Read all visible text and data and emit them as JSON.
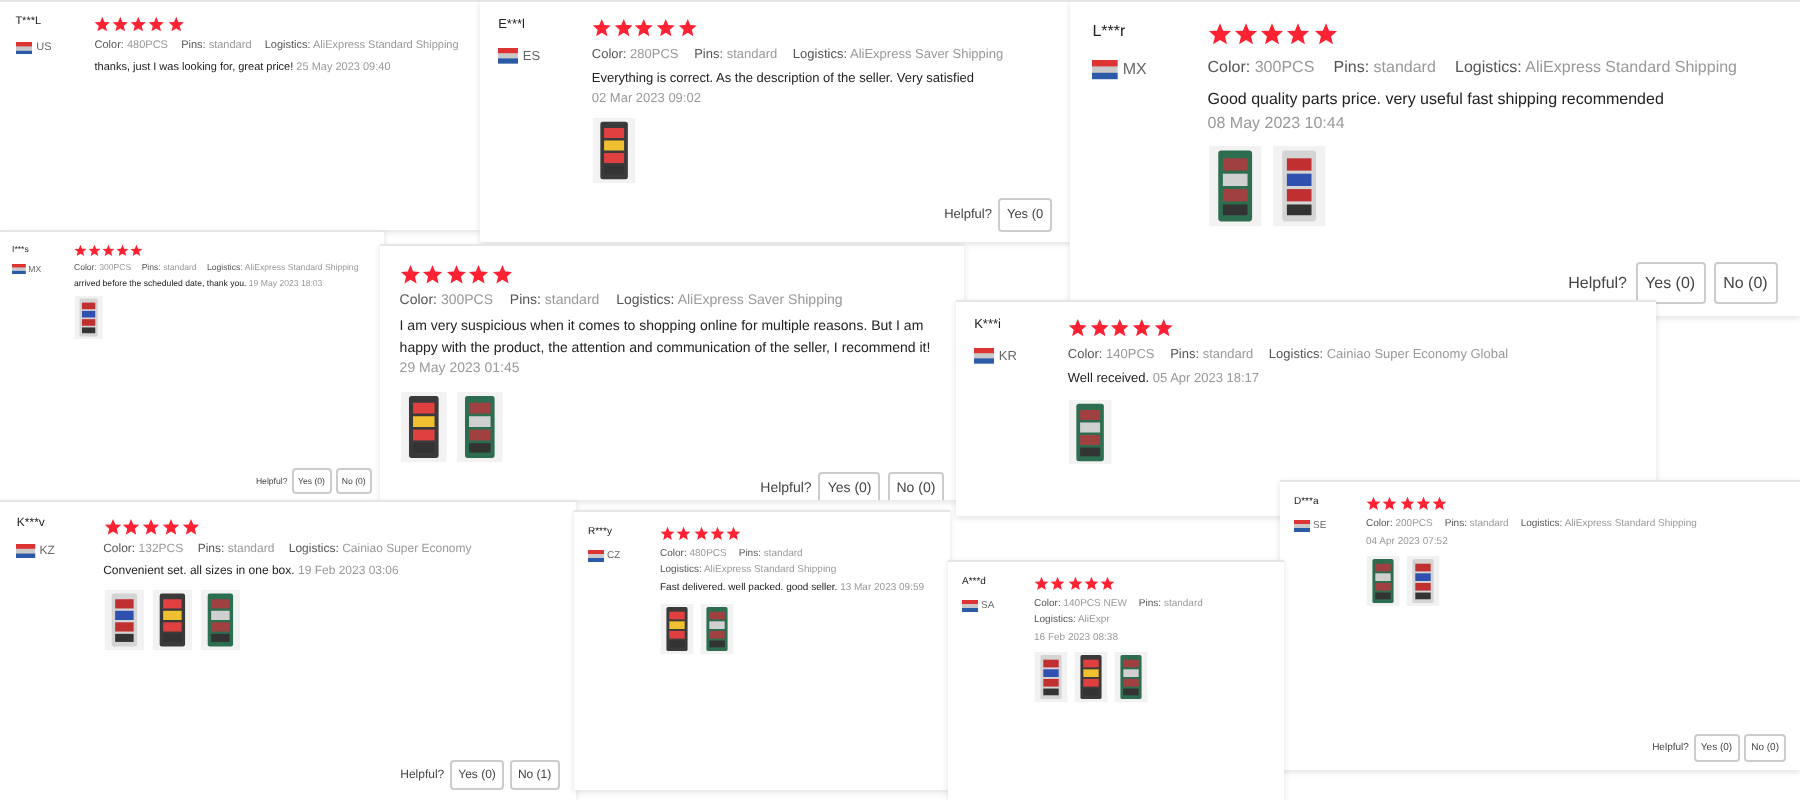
{
  "reviews": [
    {
      "name": "T***L",
      "country": "US",
      "stars": 5,
      "attributes": [
        {
          "label": "Color:",
          "value": "480PCS"
        },
        {
          "label": "Pins:",
          "value": "standard"
        },
        {
          "label": "Logistics:",
          "value": "AliExpress Standard Shipping"
        }
      ],
      "text": "thanks, just I was looking for, great price!",
      "date": "25 May 2023 09:40"
    },
    {
      "name": "E***l",
      "country": "ES",
      "stars": 5,
      "attributes": [
        {
          "label": "Color:",
          "value": "280PCS"
        },
        {
          "label": "Pins:",
          "value": "standard"
        },
        {
          "label": "Logistics:",
          "value": "AliExpress Saver Shipping"
        }
      ],
      "text": "Everything is correct. As the description of the seller. Very satisfied",
      "date": "02 Mar 2023 09:02",
      "photos": [
        {
          "kind": "picture"
        }
      ],
      "helpful": {
        "label": "Helpful?",
        "yes": "Yes (0"
      }
    },
    {
      "name": "L***r",
      "country": "MX",
      "stars": 5,
      "attributes": [
        {
          "label": "Color:",
          "value": "300PCS"
        },
        {
          "label": "Pins:",
          "value": "standard"
        },
        {
          "label": "Logistics:",
          "value": "AliExpress Standard Shipping"
        }
      ],
      "text": "Good quality parts price. very useful fast shipping recommended",
      "date": "08 May 2023 10:44",
      "photos": [
        {
          "kind": "picture"
        },
        {
          "kind": "picture"
        }
      ],
      "helpful": {
        "label": "Helpful?",
        "yes": "Yes (0)",
        "no": "No (0)"
      }
    },
    {
      "name": "I***s",
      "country": "MX",
      "stars": 5,
      "attributes": [
        {
          "label": "Color:",
          "value": "300PCS"
        },
        {
          "label": "Pins:",
          "value": "standard"
        },
        {
          "label": "Logistics:",
          "value": "AliExpress Standard Shipping"
        }
      ],
      "text": "arrived before the scheduled date, thank you.",
      "date": "19 May 2023 18:03",
      "photos": [
        {
          "kind": "picture"
        }
      ],
      "helpful": {
        "label": "Helpful?",
        "yes": "Yes (0)",
        "no": "No (0)"
      }
    },
    {
      "stars": 5,
      "attributes": [
        {
          "label": "Color:",
          "value": "300PCS"
        },
        {
          "label": "Pins:",
          "value": "standard"
        },
        {
          "label": "Logistics:",
          "value": "AliExpress Saver Shipping"
        }
      ],
      "text": "I am very suspicious when it comes to shopping online for multiple reasons. But I am happy with the product, the attention and communication of the seller, I recommend it!",
      "date": "29 May 2023 01:45",
      "photos": [
        {
          "kind": "picture"
        },
        {
          "kind": "picture"
        }
      ],
      "helpful": {
        "label": "Helpful?",
        "yes": "Yes (0)",
        "no": "No (0)"
      }
    },
    {
      "name": "K***i",
      "country": "KR",
      "stars": 5,
      "attributes": [
        {
          "label": "Color:",
          "value": "140PCS"
        },
        {
          "label": "Pins:",
          "value": "standard"
        },
        {
          "label": "Logistics:",
          "value": "Cainiao Super Economy Global"
        }
      ],
      "text": "Well received.",
      "date": "05 Apr 2023 18:17",
      "photos": [
        {
          "kind": "picture"
        }
      ]
    },
    {
      "name": "K***v",
      "country": "KZ",
      "stars": 5,
      "attributes": [
        {
          "label": "Color:",
          "value": "132PCS"
        },
        {
          "label": "Pins:",
          "value": "standard"
        },
        {
          "label": "Logistics:",
          "value": "Cainiao Super Economy"
        }
      ],
      "text": "Convenient set. all sizes in one box.",
      "date": "19 Feb 2023 03:06",
      "photos": [
        {
          "kind": "picture"
        },
        {
          "kind": "picture"
        },
        {
          "kind": "picture"
        }
      ],
      "helpful": {
        "label": "Helpful?",
        "yes": "Yes (0)",
        "no": "No (1)"
      }
    },
    {
      "name": "R***y",
      "country": "CZ",
      "stars": 5,
      "attributes": [
        {
          "label": "Color:",
          "value": "480PCS"
        },
        {
          "label": "Pins:",
          "value": "standard"
        },
        {
          "label": "Logistics:",
          "value": "AliExpress Standard Shipping"
        }
      ],
      "text": "Fast delivered. well packed. good seller.",
      "date": "13 Mar 2023 09:59",
      "photos": [
        {
          "kind": "picture"
        },
        {
          "kind": "picture"
        }
      ]
    },
    {
      "name": "D***a",
      "country": "SE",
      "stars": 5,
      "attributes": [
        {
          "label": "Color:",
          "value": "200PCS"
        },
        {
          "label": "Pins:",
          "value": "standard"
        },
        {
          "label": "Logistics:",
          "value": "AliExpress Standard Shipping"
        }
      ],
      "date": "04 Apr 2023 07:52",
      "photos": [
        {
          "kind": "picture"
        },
        {
          "kind": "picture"
        }
      ],
      "helpful": {
        "label": "Helpful?",
        "yes": "Yes (0)",
        "no": "No (0)"
      }
    },
    {
      "name": "A***d",
      "country": "SA",
      "stars": 5,
      "attributes": [
        {
          "label": "Color:",
          "value": "140PCS NEW"
        },
        {
          "label": "Pins:",
          "value": "standard"
        },
        {
          "label": "Logistics:",
          "value": "AliExpr"
        }
      ],
      "date": "16 Feb 2023 08:38",
      "photos": [
        {
          "kind": "picture"
        },
        {
          "kind": "picture"
        },
        {
          "kind": "picture"
        }
      ]
    }
  ]
}
